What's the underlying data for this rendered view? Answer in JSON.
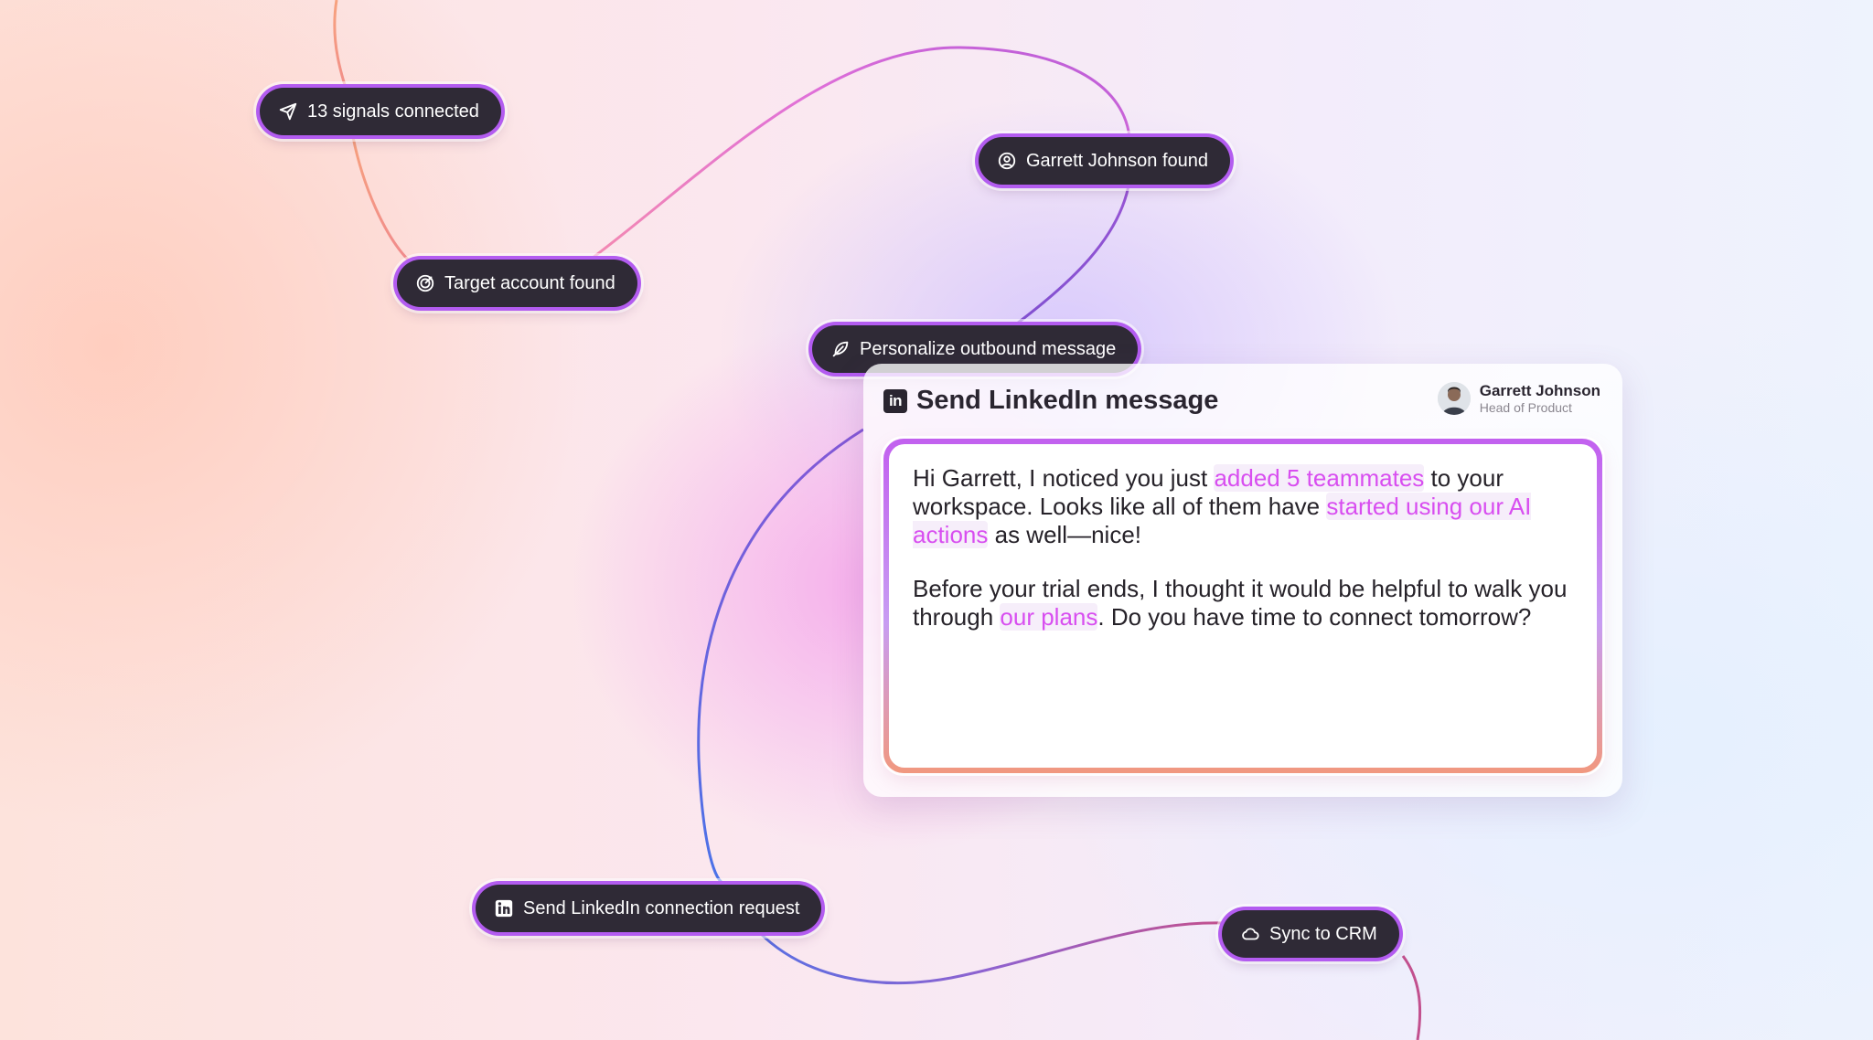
{
  "nodes": {
    "signals": "13 signals connected",
    "target_account": "Target account found",
    "person_found": "Garrett Johnson found",
    "personalize": "Personalize outbound message",
    "connection_request": "Send LinkedIn connection request",
    "sync_crm": "Sync to CRM"
  },
  "card": {
    "title": "Send LinkedIn message",
    "linkedin_glyph": "in",
    "profile_name": "Garrett Johnson",
    "profile_role": "Head of Product"
  },
  "message": {
    "p1_a": "Hi Garrett, I noticed you just ",
    "p1_hl1": "added 5 teammates",
    "p1_b": " to your workspace. Looks like all of them have ",
    "p1_hl2": "started using our AI actions",
    "p1_c": " as well—nice!",
    "p2_a": "Before your trial ends, I thought it would be helpful to walk you through ",
    "p2_hl": "our plans",
    "p2_b": ". Do you have time to connect tomorrow?"
  },
  "icons": {
    "signals": "send-icon",
    "target": "target-icon",
    "person": "user-circle-icon",
    "personalize": "feather-icon",
    "linkedin": "linkedin-icon",
    "crm": "cloud-icon"
  },
  "colors": {
    "pill_bg": "#2f2a36",
    "pill_ring": "#b35cf0",
    "highlight": "#d84ef0"
  }
}
